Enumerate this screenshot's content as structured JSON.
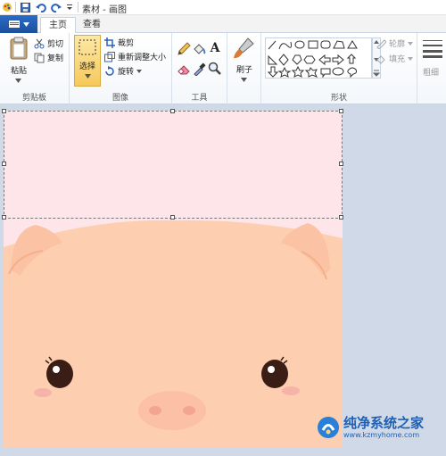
{
  "window": {
    "title": "素材 - 画图"
  },
  "tabs": {
    "home": "主页",
    "view": "查看"
  },
  "clipboard": {
    "paste": "粘贴",
    "cut": "剪切",
    "copy": "复制",
    "group": "剪贴板"
  },
  "image": {
    "select": "选择",
    "crop": "裁剪",
    "resize": "重新调整大小",
    "rotate": "旋转",
    "group": "图像"
  },
  "tools": {
    "group": "工具"
  },
  "brushes": {
    "label": "刷子"
  },
  "shapes": {
    "group": "形状",
    "outline": "轮廓",
    "fill": "填充"
  },
  "size": {
    "label": "粗细"
  },
  "watermark": {
    "name": "纯净系统之家",
    "url": "www.kzmyhome.com"
  },
  "colors": {
    "canvas_bg": "#fde5ea",
    "pig": "#fdcfb0",
    "accent": "#f7d77a"
  }
}
